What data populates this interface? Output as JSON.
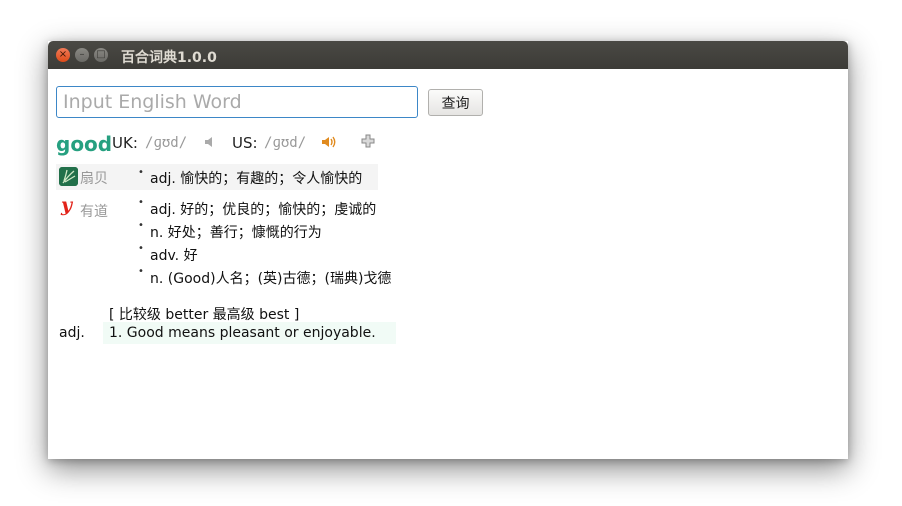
{
  "window": {
    "title": "百合词典1.0.0",
    "controls": {
      "close": "×",
      "minimize": "–",
      "maximize": "□"
    }
  },
  "search": {
    "placeholder": "Input English Word",
    "value": "",
    "button_label": "查询"
  },
  "entry": {
    "word": "good",
    "uk_label": "UK:",
    "uk_phonetic": "/ɡʊd/",
    "us_label": "US:",
    "us_phonetic": "/ɡʊd/",
    "icons": [
      "speaker-icon",
      "speaker-icon",
      "plus-icon"
    ]
  },
  "sources": [
    {
      "name": "扇贝",
      "icon": "shanbay-logo-icon",
      "definitions": [
        "adj. 愉快的；有趣的；令人愉快的"
      ]
    },
    {
      "name": "有道",
      "icon": "youdao-logo-icon",
      "logo_text": "y",
      "definitions": [
        "adj. 好的；优良的；愉快的；虔诚的",
        "n. 好处；善行；慷慨的行为",
        "adv. 好",
        "n. (Good)人名；(英)古德；(瑞典)戈德"
      ]
    }
  ],
  "collins": {
    "forms": "[ 比较级 better 最高级 best ]",
    "pos": "adj.",
    "sense": "1. Good means pleasant or enjoyable."
  },
  "colors": {
    "word": "#26a080",
    "input_border": "#3d87c7",
    "titlebar": "#3c3b37",
    "close_button": "#e95420",
    "youdao": "#e2231a",
    "shanbay": "#22704a"
  }
}
